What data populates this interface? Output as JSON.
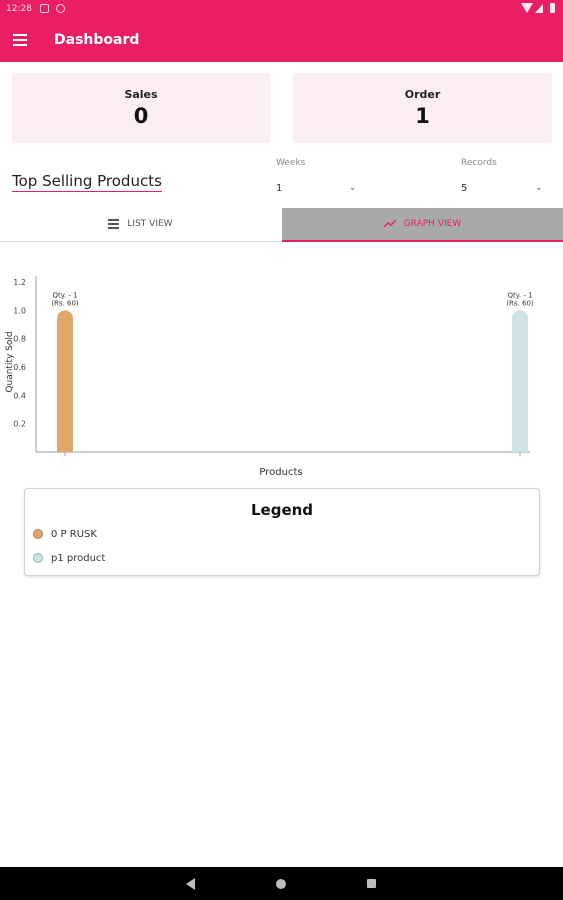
{
  "status": {
    "time": "12:28"
  },
  "appbar": {
    "title": "Dashboard"
  },
  "cards": [
    {
      "label": "Sales",
      "value": "0"
    },
    {
      "label": "Order",
      "value": "1"
    }
  ],
  "section": {
    "title": "Top Selling Products"
  },
  "filters": {
    "weeks": {
      "label": "Weeks",
      "value": "1"
    },
    "records": {
      "label": "Records",
      "value": "5"
    }
  },
  "tabs": {
    "list": "LIST VIEW",
    "graph": "GRAPH VIEW"
  },
  "colors": {
    "accent": "#e91e63",
    "card_bg": "#fdeef2",
    "series_1": "#e0a86a",
    "series_2": "#cde3e8"
  },
  "chart_data": {
    "type": "bar",
    "categories": [
      "0 P RUSK",
      "p1 product"
    ],
    "values": [
      1,
      1
    ],
    "data_labels": [
      {
        "line1": "Qty. - 1",
        "line2": "(Rs. 60)"
      },
      {
        "line1": "Qty. - 1",
        "line2": "(Rs. 60)"
      }
    ],
    "xlabel": "Products",
    "ylabel": "Quantity Sold",
    "yticks": [
      "0.2",
      "0.4",
      "0.6",
      "0.8",
      "1.0",
      "1.2"
    ],
    "ylim": [
      0,
      1.2
    ],
    "colors": [
      "#e0a86a",
      "#cde3e8"
    ],
    "grid": false,
    "legend_position": "bottom"
  },
  "legend": {
    "title": "Legend",
    "items": [
      {
        "label": "0 P RUSK",
        "color": "#e0a86a"
      },
      {
        "label": "p1 product",
        "color": "#cde3e8"
      }
    ]
  }
}
